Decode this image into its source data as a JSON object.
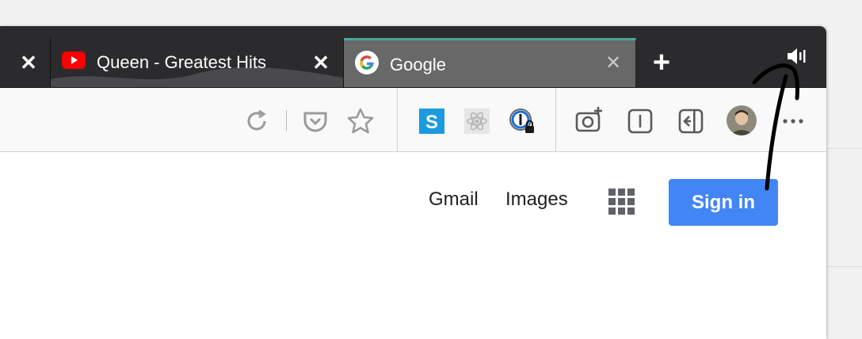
{
  "tabs": [
    {
      "title": "",
      "active": false
    },
    {
      "title": "Queen - Greatest Hits",
      "active": false,
      "favicon": "youtube-icon"
    },
    {
      "title": "Google",
      "active": true,
      "favicon": "google-g-icon"
    }
  ],
  "tab_close_glyph": "✕",
  "new_tab_glyph": "+",
  "toolbar_icons": [
    "reload-icon",
    "pocket-icon",
    "star-icon",
    "s-extension-icon",
    "react-devtools-icon",
    "onepassword-icon",
    "screenshot-icon",
    "reader-icon",
    "sidebar-icon",
    "avatar",
    "more-icon"
  ],
  "colors": {
    "active_tab_accent": "#48a99a",
    "sign_in_blue": "#4285f4"
  },
  "page": {
    "gmail": "Gmail",
    "images": "Images",
    "sign_in": "Sign in"
  }
}
